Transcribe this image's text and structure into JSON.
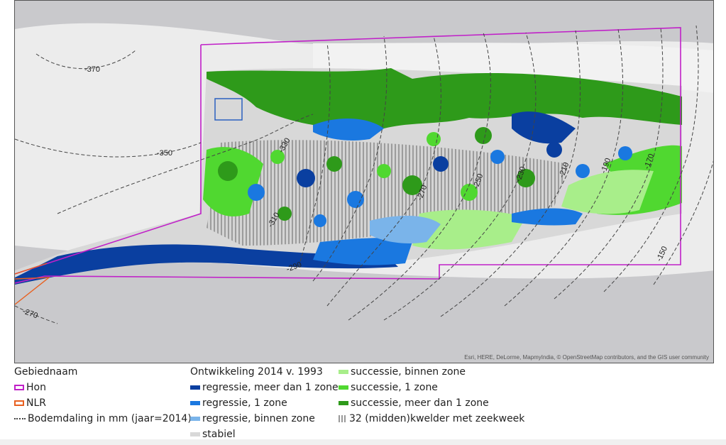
{
  "map": {
    "attribution": "Esri, HERE, DeLorme, MapmyIndia, © OpenStreetMap contributors, and the GIS user community",
    "contours": [
      "-370",
      "-350",
      "-330",
      "-310",
      "-290",
      "-270",
      "-270",
      "-250",
      "-230",
      "-210",
      "-190",
      "-170",
      "-150"
    ]
  },
  "legend": {
    "gebiednaam": {
      "title": "Gebiednaam",
      "items": [
        {
          "label": "Hon",
          "color": "#c020c8"
        },
        {
          "label": "NLR",
          "color": "#e86020"
        }
      ],
      "bodemdaling": "Bodemdaling in mm (jaar=2014)"
    },
    "ontwikkeling": {
      "title": "Ontwikkeling 2014 v. 1993",
      "items": [
        {
          "label": "regressie, meer dan 1 zone",
          "color": "#0a3fa0"
        },
        {
          "label": "regressie, 1 zone",
          "color": "#1a78e0"
        },
        {
          "label": "regressie, binnen zone",
          "color": "#7ab4ea"
        },
        {
          "label": "stabiel",
          "color": "#d8d8d8"
        }
      ]
    },
    "successie": {
      "items": [
        {
          "label": "successie, binnen zone",
          "color": "#a8ee8a"
        },
        {
          "label": "successie, 1 zone",
          "color": "#50d830"
        },
        {
          "label": "successie, meer dan 1 zone",
          "color": "#2e9a1a"
        }
      ],
      "hatch_label": "32 (midden)kwelder met zeekweek"
    }
  }
}
